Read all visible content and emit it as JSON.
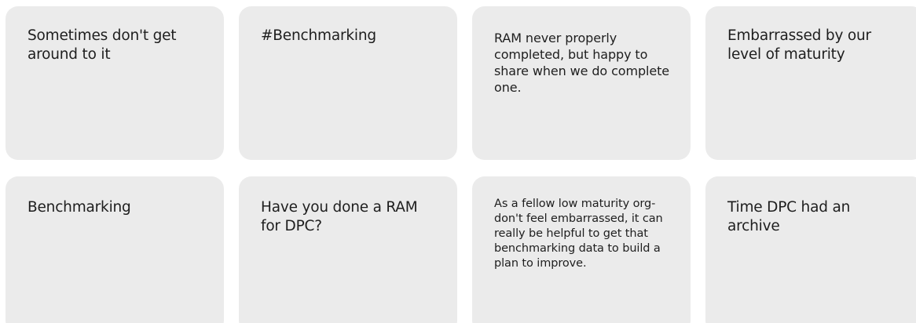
{
  "notes": [
    {
      "text": "Sometimes don't get around to it"
    },
    {
      "text": "#Benchmarking"
    },
    {
      "text": "RAM never properly completed, but happy to share when we do complete one."
    },
    {
      "text": "Embarrassed by our level of maturity"
    },
    {
      "text": "Benchmarking"
    },
    {
      "text": "Have you done a RAM for DPC?"
    },
    {
      "text": "As a fellow low maturity org- don't feel embarrassed, it can really be helpful to get that benchmarking data to build a plan to improve."
    },
    {
      "text": "Time DPC had an archive"
    }
  ],
  "colors": {
    "card_background": "#ebebeb",
    "text": "#1e1e1e",
    "page_background": "#ffffff"
  }
}
